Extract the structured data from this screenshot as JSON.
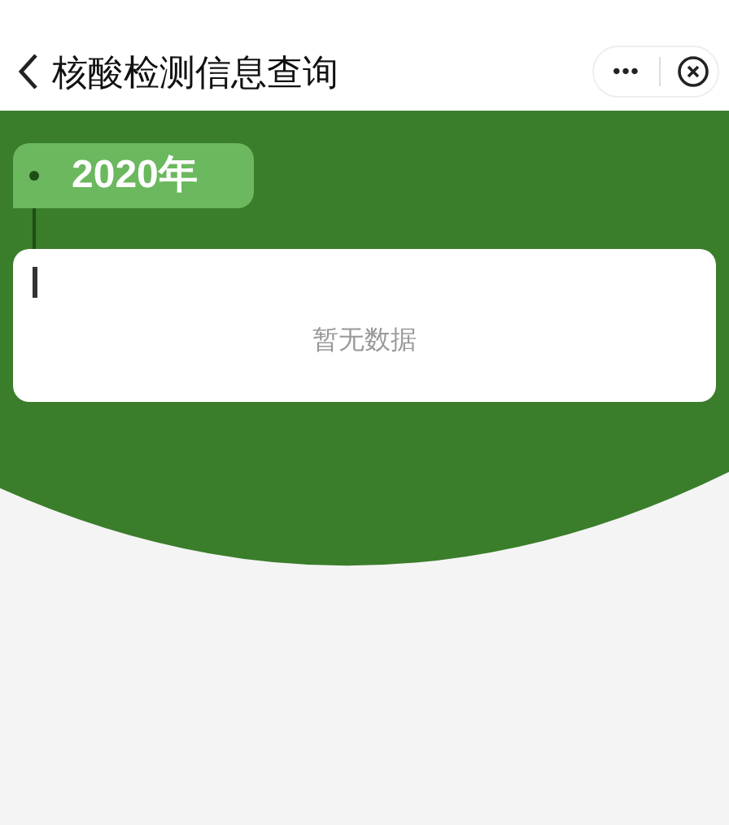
{
  "nav_bar": {
    "title": "核酸检测信息查询",
    "more_icon": "•••"
  },
  "timeline": [
    {
      "year": "2020年",
      "message": "暂无数据"
    }
  ]
}
